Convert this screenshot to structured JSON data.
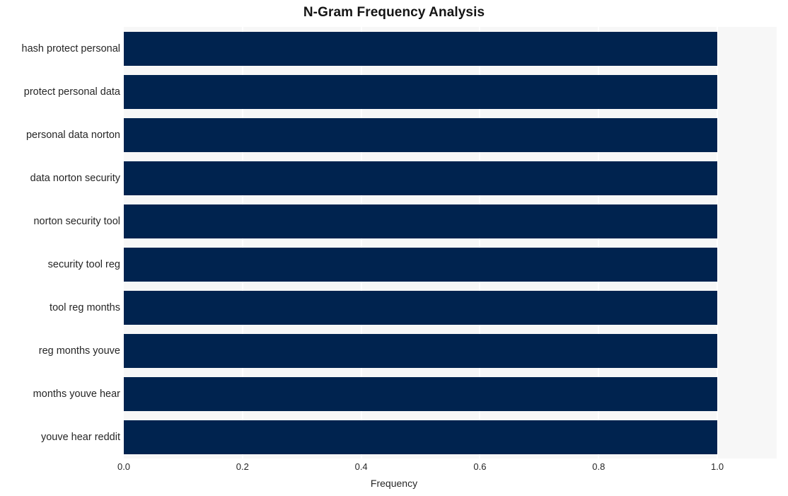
{
  "chart_data": {
    "type": "bar",
    "orientation": "horizontal",
    "title": "N-Gram Frequency Analysis",
    "xlabel": "Frequency",
    "ylabel": "",
    "categories": [
      "hash protect personal",
      "protect personal data",
      "personal data norton",
      "data norton security",
      "norton security tool",
      "security tool reg",
      "tool reg months",
      "reg months youve",
      "months youve hear",
      "youve hear reddit"
    ],
    "values": [
      1.0,
      1.0,
      1.0,
      1.0,
      1.0,
      1.0,
      1.0,
      1.0,
      1.0,
      1.0
    ],
    "xlim": [
      0.0,
      1.1
    ],
    "xticks": [
      0.0,
      0.2,
      0.4,
      0.6,
      0.8,
      1.0
    ],
    "xtick_labels": [
      "0.0",
      "0.2",
      "0.4",
      "0.6",
      "0.8",
      "1.0"
    ],
    "grid": true,
    "grid_axis": "x",
    "legend": null,
    "bar_color": "#00234f",
    "plot_background": "#f7f7f7",
    "gridline_color": "#ffffff",
    "figure_background": "#ffffff",
    "text_color": "#262626"
  }
}
